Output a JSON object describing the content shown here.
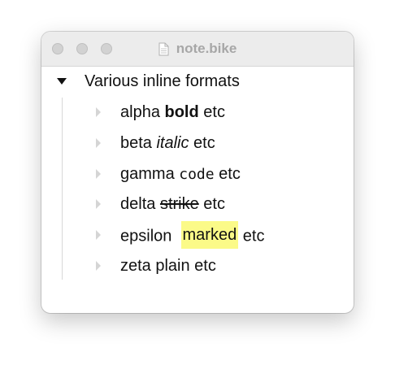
{
  "window": {
    "title": "note.bike",
    "title_icon": "document-icon",
    "traffic_lights": [
      "close",
      "minimize",
      "zoom"
    ]
  },
  "outline": {
    "root": {
      "label": "Various inline formats",
      "expanded": true
    },
    "children": [
      {
        "parts": [
          {
            "text": "alpha ",
            "style": "plain"
          },
          {
            "text": "bold",
            "style": "bold"
          },
          {
            "text": " etc",
            "style": "plain"
          }
        ],
        "expanded": false
      },
      {
        "parts": [
          {
            "text": "beta ",
            "style": "plain"
          },
          {
            "text": "italic",
            "style": "italic"
          },
          {
            "text": " etc",
            "style": "plain"
          }
        ],
        "expanded": false
      },
      {
        "parts": [
          {
            "text": "gamma ",
            "style": "plain"
          },
          {
            "text": "code",
            "style": "code"
          },
          {
            "text": " etc",
            "style": "plain"
          }
        ],
        "expanded": false
      },
      {
        "parts": [
          {
            "text": "delta ",
            "style": "plain"
          },
          {
            "text": "strike",
            "style": "strikethrough"
          },
          {
            "text": " etc",
            "style": "plain"
          }
        ],
        "expanded": false
      },
      {
        "parts": [
          {
            "text": "epsilon  ",
            "style": "plain"
          },
          {
            "text": "marked",
            "style": "highlight"
          },
          {
            "text": " etc",
            "style": "plain"
          }
        ],
        "expanded": false
      },
      {
        "parts": [
          {
            "text": "zeta plain etc",
            "style": "plain"
          }
        ],
        "expanded": false
      }
    ]
  },
  "colors": {
    "highlight": "#fbfa88",
    "titlebar": "#ececec",
    "title_text": "#a7a7a7"
  }
}
